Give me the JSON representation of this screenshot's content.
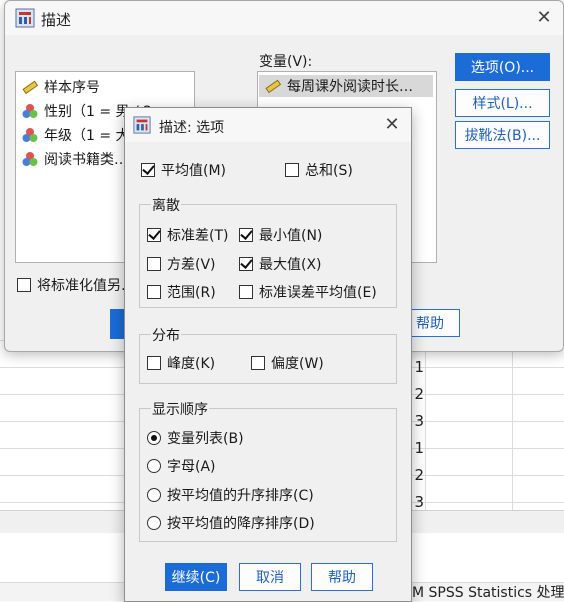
{
  "background": {
    "row_numbers": [
      "1",
      "2",
      "3",
      "1",
      "2",
      "3"
    ],
    "status_text": "M SPSS Statistics 处理"
  },
  "main_dialog": {
    "title": "描述",
    "variables": [
      {
        "label": "样本序号",
        "icon": "ruler-icon"
      },
      {
        "label": "性别（1 = 男 / 2…",
        "icon": "nominal-icon"
      },
      {
        "label": "年级（1 = 大一…",
        "icon": "nominal-icon"
      },
      {
        "label": "阅读书籍类…",
        "icon": "nominal-icon"
      }
    ],
    "target_label": "变量(V):",
    "target_items": [
      {
        "label": "每周课外阅读时长…",
        "icon": "ruler-icon"
      }
    ],
    "buttons": {
      "options": "选项(O)...",
      "style": "样式(L)...",
      "bootstrap": "拔靴法(B)...",
      "help": "帮助"
    },
    "standardize_label": "将标准化值另…",
    "standardize_checked": false
  },
  "options_dialog": {
    "title": "描述: 选项",
    "mean": {
      "label": "平均值(M)",
      "checked": true
    },
    "sum": {
      "label": "总和(S)",
      "checked": false
    },
    "dispersion": {
      "title": "离散",
      "std": {
        "label": "标准差(T)",
        "checked": true
      },
      "min": {
        "label": "最小值(N)",
        "checked": true
      },
      "variance": {
        "label": "方差(V)",
        "checked": false
      },
      "max": {
        "label": "最大值(X)",
        "checked": true
      },
      "range": {
        "label": "范围(R)",
        "checked": false
      },
      "se_mean": {
        "label": "标准误差平均值(E)",
        "checked": false
      }
    },
    "distribution": {
      "title": "分布",
      "kurtosis": {
        "label": "峰度(K)",
        "checked": false
      },
      "skewness": {
        "label": "偏度(W)",
        "checked": false
      }
    },
    "display_order": {
      "title": "显示顺序",
      "options": [
        {
          "label": "变量列表(B)",
          "selected": true
        },
        {
          "label": "字母(A)",
          "selected": false
        },
        {
          "label": "按平均值的升序排序(C)",
          "selected": false
        },
        {
          "label": "按平均值的降序排序(D)",
          "selected": false
        }
      ]
    },
    "buttons": {
      "continue": "继续(C)",
      "cancel": "取消",
      "help": "帮助"
    }
  },
  "colors": {
    "accent": "#1c6cd8",
    "dialog_bg": "#f0f0f0"
  }
}
